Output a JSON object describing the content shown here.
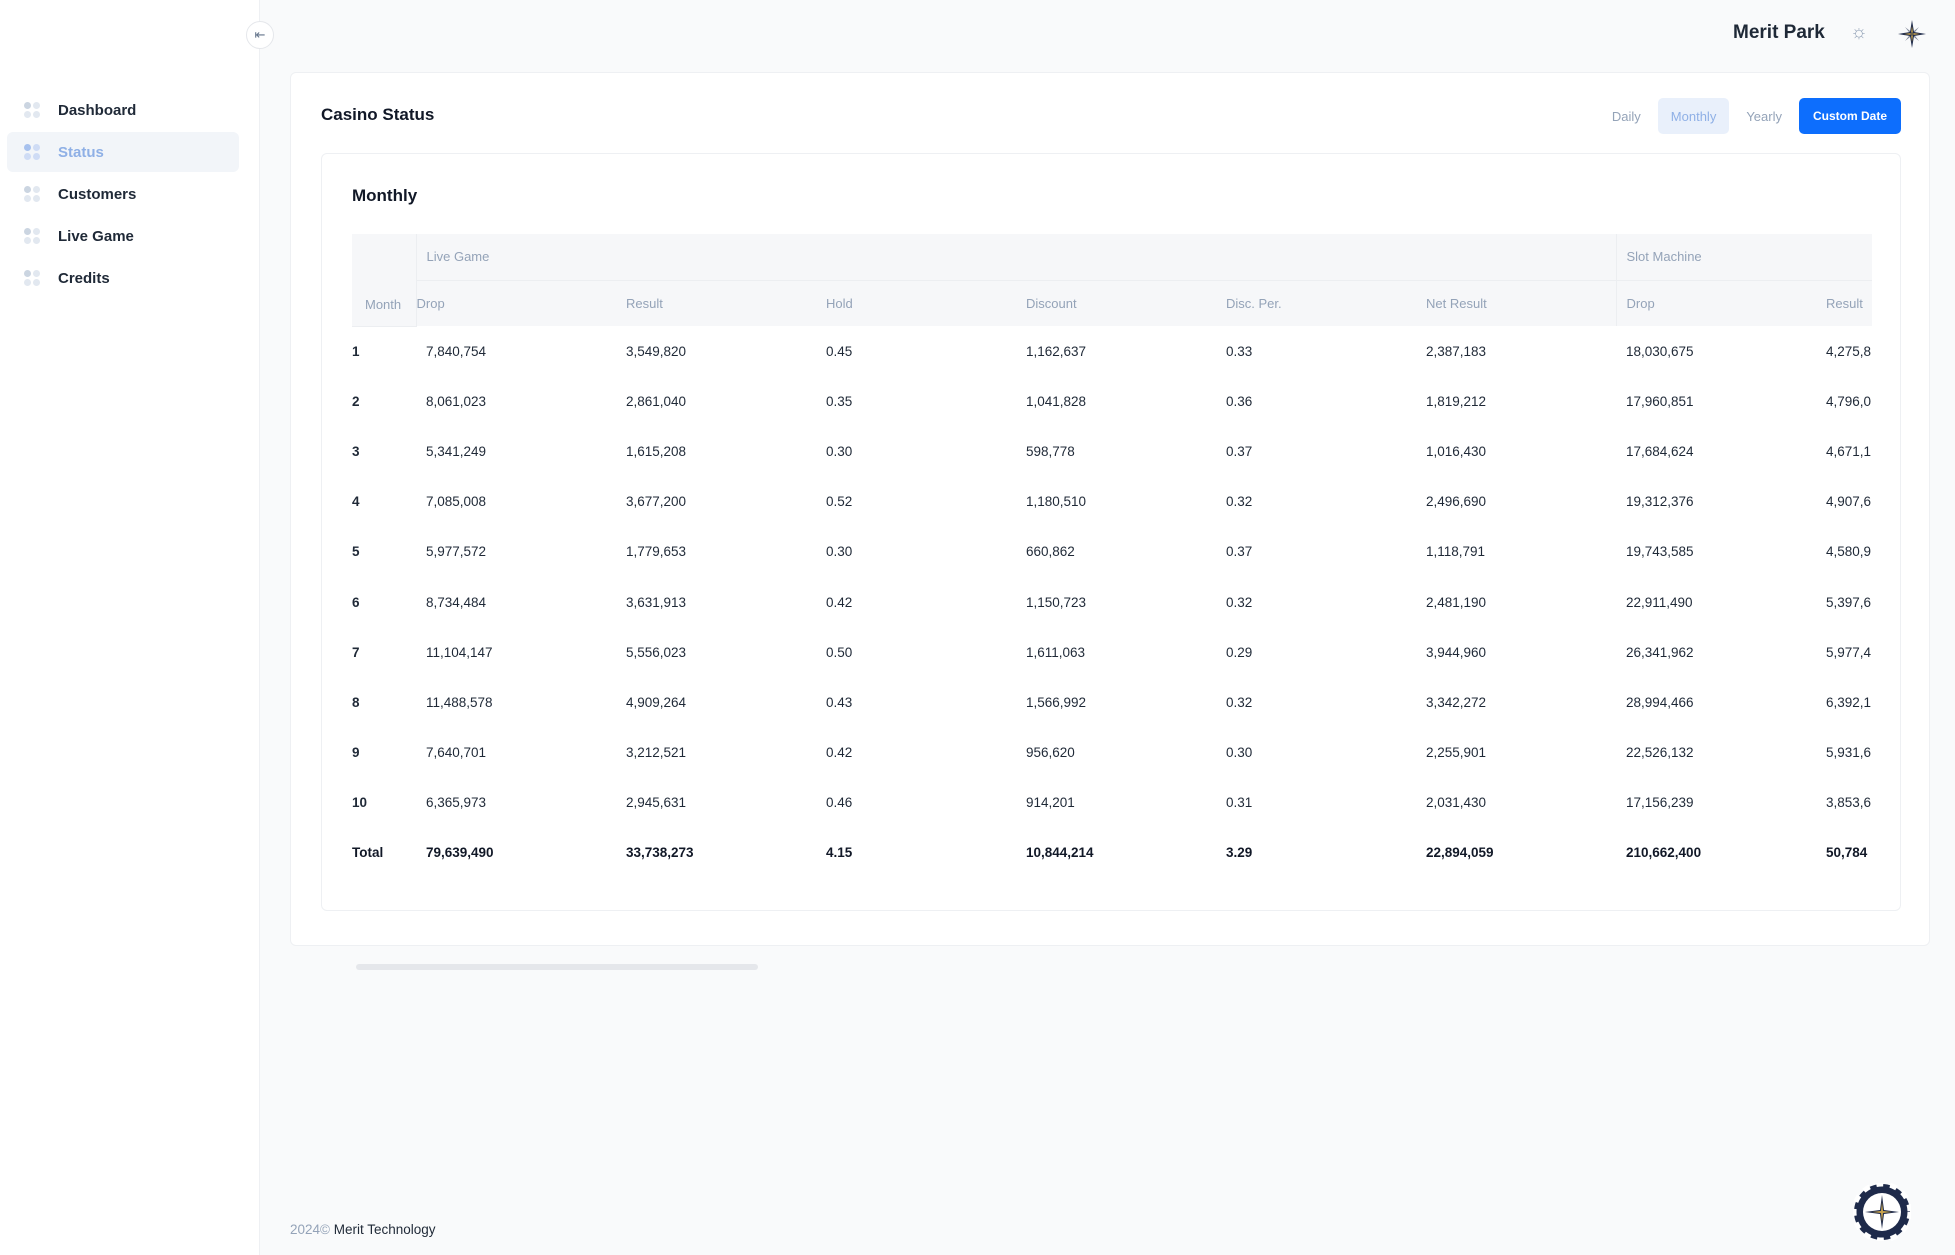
{
  "header": {
    "title": "Merit Park"
  },
  "sidebar": {
    "items": [
      {
        "label": "Dashboard"
      },
      {
        "label": "Status"
      },
      {
        "label": "Customers"
      },
      {
        "label": "Live Game"
      },
      {
        "label": "Credits"
      }
    ],
    "active": "Status"
  },
  "main": {
    "title": "Casino Status",
    "tabs": {
      "daily": "Daily",
      "monthly": "Monthly",
      "yearly": "Yearly",
      "custom": "Custom Date"
    },
    "active_tab": "Monthly"
  },
  "table": {
    "title": "Monthly",
    "groups": {
      "live_game": "Live Game",
      "slot_machine": "Slot Machine"
    },
    "columns": [
      "Month",
      "Drop",
      "Result",
      "Hold",
      "Discount",
      "Disc. Per.",
      "Net Result",
      "Drop",
      "Result"
    ],
    "rows": [
      {
        "month": "1",
        "cells": [
          "7,840,754",
          "3,549,820",
          "0.45",
          "1,162,637",
          "0.33",
          "2,387,183",
          "18,030,675",
          "4,275,8"
        ]
      },
      {
        "month": "2",
        "cells": [
          "8,061,023",
          "2,861,040",
          "0.35",
          "1,041,828",
          "0.36",
          "1,819,212",
          "17,960,851",
          "4,796,0"
        ]
      },
      {
        "month": "3",
        "cells": [
          "5,341,249",
          "1,615,208",
          "0.30",
          "598,778",
          "0.37",
          "1,016,430",
          "17,684,624",
          "4,671,1"
        ]
      },
      {
        "month": "4",
        "cells": [
          "7,085,008",
          "3,677,200",
          "0.52",
          "1,180,510",
          "0.32",
          "2,496,690",
          "19,312,376",
          "4,907,6"
        ]
      },
      {
        "month": "5",
        "cells": [
          "5,977,572",
          "1,779,653",
          "0.30",
          "660,862",
          "0.37",
          "1,118,791",
          "19,743,585",
          "4,580,9"
        ]
      },
      {
        "month": "6",
        "cells": [
          "8,734,484",
          "3,631,913",
          "0.42",
          "1,150,723",
          "0.32",
          "2,481,190",
          "22,911,490",
          "5,397,6"
        ]
      },
      {
        "month": "7",
        "cells": [
          "11,104,147",
          "5,556,023",
          "0.50",
          "1,611,063",
          "0.29",
          "3,944,960",
          "26,341,962",
          "5,977,4"
        ]
      },
      {
        "month": "8",
        "cells": [
          "11,488,578",
          "4,909,264",
          "0.43",
          "1,566,992",
          "0.32",
          "3,342,272",
          "28,994,466",
          "6,392,1"
        ]
      },
      {
        "month": "9",
        "cells": [
          "7,640,701",
          "3,212,521",
          "0.42",
          "956,620",
          "0.30",
          "2,255,901",
          "22,526,132",
          "5,931,6"
        ]
      },
      {
        "month": "10",
        "cells": [
          "6,365,973",
          "2,945,631",
          "0.46",
          "914,201",
          "0.31",
          "2,031,430",
          "17,156,239",
          "3,853,6"
        ]
      }
    ],
    "total": {
      "label": "Total",
      "cells": [
        "79,639,490",
        "33,738,273",
        "4.15",
        "10,844,214",
        "3.29",
        "22,894,059",
        "210,662,400",
        "50,784"
      ]
    }
  },
  "footer": {
    "year": "2024©",
    "company": "Merit Technology"
  },
  "colors": {
    "accent": "#0d6efd",
    "active_nav": "#8fb0e6"
  },
  "icons": {
    "collapse": "arrow-left-icon",
    "theme": "sun-icon",
    "brand": "compass-star-icon",
    "chip": "casino-chip-icon"
  }
}
